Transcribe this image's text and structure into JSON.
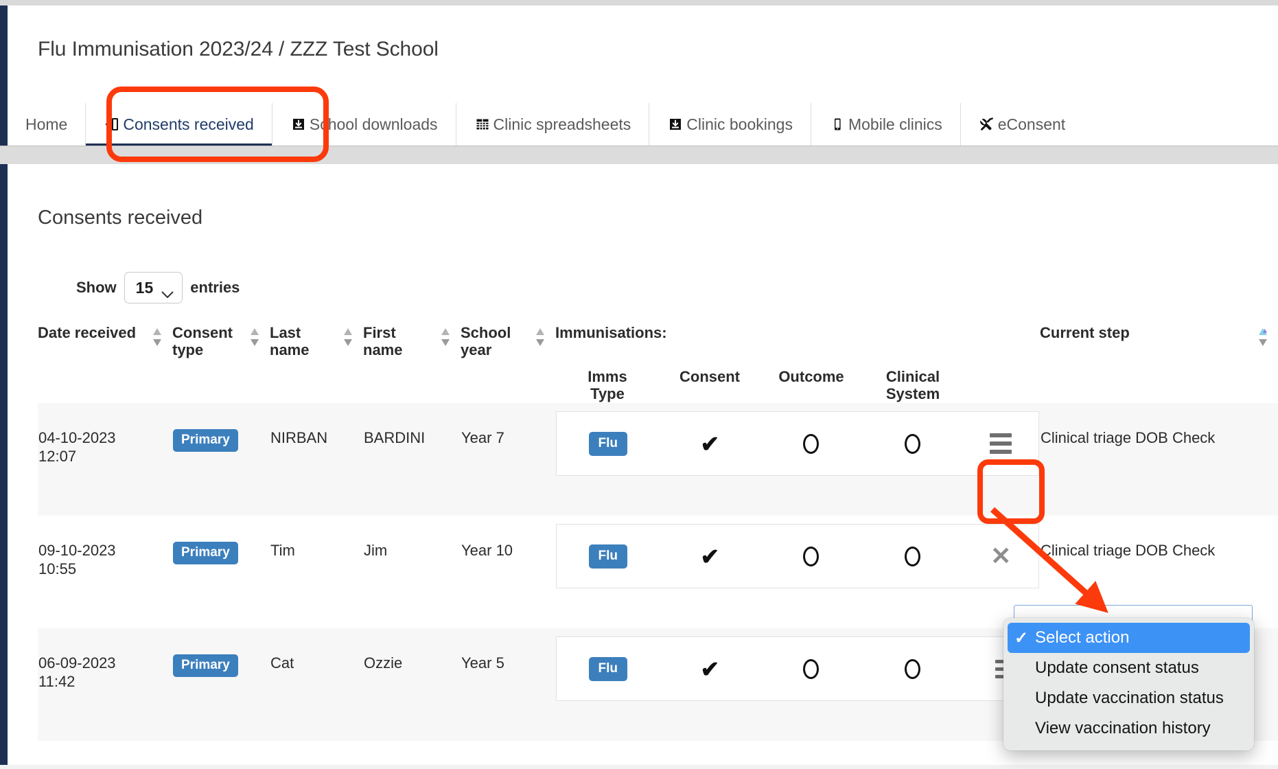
{
  "header": {
    "title": "Flu Immunisation 2023/24 / ZZZ Test School"
  },
  "nav": {
    "tabs": [
      {
        "label": "Home",
        "icon": "none",
        "active": false
      },
      {
        "label": "Consents received",
        "icon": "sign-in-icon",
        "active": true
      },
      {
        "label": "School downloads",
        "icon": "download-box-icon",
        "active": false
      },
      {
        "label": "Clinic spreadsheets",
        "icon": "grid-table-icon",
        "active": false
      },
      {
        "label": "Clinic bookings",
        "icon": "download-box-icon",
        "active": false
      },
      {
        "label": "Mobile clinics",
        "icon": "mobile-phone-icon",
        "active": false
      },
      {
        "label": "eConsent",
        "icon": "tools-icon",
        "active": false
      }
    ]
  },
  "section": {
    "heading": "Consents received"
  },
  "controls": {
    "show_label": "Show",
    "entries_value": "15",
    "entries_label": "entries"
  },
  "table": {
    "columns": [
      {
        "label": "Date received",
        "sortable": true,
        "sorted": "none"
      },
      {
        "label": "Consent type",
        "sortable": true,
        "sorted": "none"
      },
      {
        "label": "Last name",
        "sortable": true,
        "sorted": "none"
      },
      {
        "label": "First name",
        "sortable": true,
        "sorted": "none"
      },
      {
        "label": "School year",
        "sortable": true,
        "sorted": "none"
      }
    ],
    "col_date": "Date received",
    "col_consent_type_l1": "Consent",
    "col_consent_type_l2": "type",
    "col_last_l1": "Last",
    "col_last_l2": "name",
    "col_first_l1": "First",
    "col_first_l2": "name",
    "col_school_l1": "School",
    "col_school_l2": "year",
    "imms_group": "Immunisations:",
    "imms_sub": {
      "type_l1": "Imms",
      "type_l2": "Type",
      "consent": "Consent",
      "outcome": "Outcome",
      "clinical_l1": "Clinical",
      "clinical_l2": "System"
    },
    "col_current_step": "Current step",
    "rows": [
      {
        "date": "04-10-2023",
        "time": "12:07",
        "consent_type": "Primary",
        "last_name": "NIRBAN",
        "first_name": "BARDINI",
        "school_year": "Year 7",
        "imms_type": "Flu",
        "consent_mark": "check",
        "outcome_mark": "circle",
        "clinical_mark": "circle",
        "action_icon": "hamburger-menu-icon",
        "current_step": "Clinical triage DOB Check",
        "shaded": true
      },
      {
        "date": "09-10-2023",
        "time": "10:55",
        "consent_type": "Primary",
        "last_name": "Tim",
        "first_name": "Jim",
        "school_year": "Year 10",
        "imms_type": "Flu",
        "consent_mark": "check",
        "outcome_mark": "circle",
        "clinical_mark": "circle",
        "action_icon": "close-x-icon",
        "current_step": "Clinical triage DOB Check",
        "shaded": false
      },
      {
        "date": "06-09-2023",
        "time": "11:42",
        "consent_type": "Primary",
        "last_name": "Cat",
        "first_name": "Ozzie",
        "school_year": "Year 5",
        "imms_type": "Flu",
        "consent_mark": "check",
        "outcome_mark": "circle",
        "clinical_mark": "circle",
        "action_icon": "hamburger-menu-icon",
        "current_step": "",
        "shaded": true
      }
    ]
  },
  "action_menu": {
    "items": [
      {
        "label": "Select action",
        "selected": true
      },
      {
        "label": "Update consent status",
        "selected": false
      },
      {
        "label": "Update vaccination status",
        "selected": false
      },
      {
        "label": "View vaccination history",
        "selected": false
      }
    ]
  },
  "colors": {
    "brand_navy": "#1d3054",
    "badge_blue": "#3c7fbd",
    "highlight_red": "#fc3a0b",
    "menu_select_blue": "#3d92f5",
    "sort_active_blue": "#87cfe8"
  }
}
